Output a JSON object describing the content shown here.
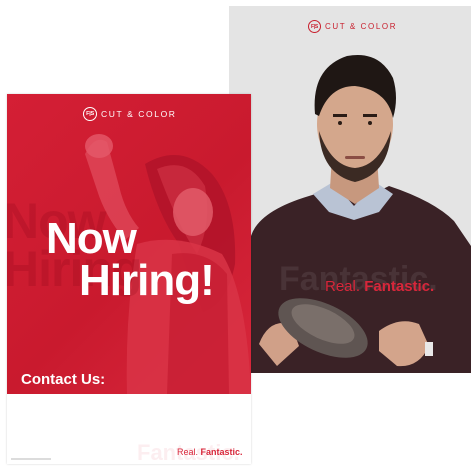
{
  "back_poster": {
    "logo_mark": "F|S",
    "brand": "CUT & COLOR",
    "tagline_regular": "Real.",
    "tagline_bold": "Fantastic.",
    "ghost_text": "Fantastic.",
    "photo": "man-holding-hat-photo"
  },
  "front_poster": {
    "logo_mark": "F|S",
    "brand": "CUT & COLOR",
    "ghost_line1": "Now",
    "ghost_line2": "Hiring",
    "headline_line1": "Now",
    "headline_line2": "Hiring!",
    "contact_label": "Contact Us:",
    "ghost_bottom": "Fantastic.",
    "tagline_regular": "Real.",
    "tagline_bold": "Fantastic.",
    "photo": "woman-dancing-photo"
  },
  "colors": {
    "brand_red": "#d41f35",
    "back_background": "#e4e4e4",
    "white": "#ffffff"
  }
}
